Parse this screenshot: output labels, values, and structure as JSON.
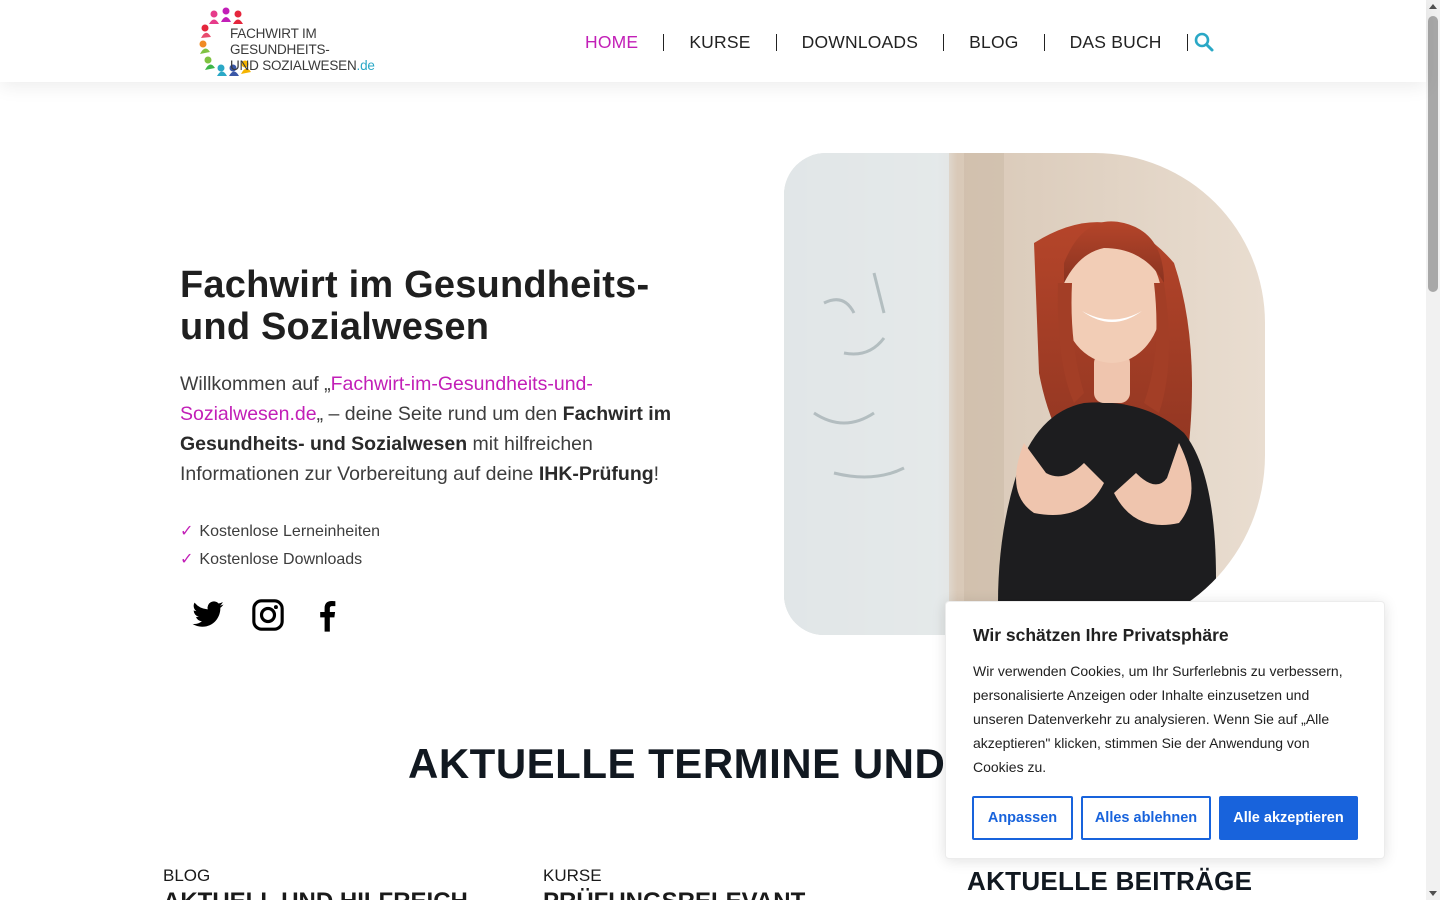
{
  "header": {
    "logo_line1": "FACHWIRT IM GESUNDHEITS-",
    "logo_line2": "UND SOZIALWESEN",
    "logo_tld": ".de",
    "nav": [
      {
        "label": "HOME",
        "active": true
      },
      {
        "label": "KURSE"
      },
      {
        "label": "DOWNLOADS"
      },
      {
        "label": "BLOG"
      },
      {
        "label": "DAS BUCH"
      }
    ],
    "search_icon": "search-icon"
  },
  "hero": {
    "title": "Fachwirt im Gesundheits- und Sozialwesen",
    "intro_prefix": "Willkommen auf „",
    "intro_link": "Fachwirt-im-Gesundheits-und-Sozialwesen.de",
    "intro_mid1": "„ – deine Seite rund um den ",
    "intro_bold1": "Fachwirt im Gesundheits- und Sozialwesen",
    "intro_mid2": " mit hilfreichen Informationen zur Vorbereitung auf deine ",
    "intro_bold2": "IHK-Prüfung",
    "intro_suffix": "!",
    "checkmark": "✓",
    "checklist": [
      "Kostenlose Lerneinheiten",
      "Kostenlose Downloads"
    ],
    "social_icons": [
      "twitter-icon",
      "instagram-icon",
      "facebook-icon"
    ]
  },
  "section": {
    "title": "AKTUELLE TERMINE UND NEWS",
    "columns": [
      {
        "label": "BLOG",
        "heading": "AKTUELL UND HILFREICH"
      },
      {
        "label": "KURSE",
        "heading": "PRÜFUNGSRELEVANT"
      }
    ],
    "sidebar_title": "AKTUELLE BEITRÄGE"
  },
  "cookie": {
    "title": "Wir schätzen Ihre Privatsphäre",
    "text": "Wir verwenden Cookies, um Ihr Surferlebnis zu verbessern, personalisierte Anzeigen oder Inhalte einzusetzen und unseren Datenverkehr zu analysieren. Wenn Sie auf „Alle akzeptieren\" klicken, stimmen Sie der Anwendung von Cookies zu.",
    "customize": "Anpassen",
    "reject": "Alles ablehnen",
    "accept": "Alle akzeptieren"
  },
  "colors": {
    "accent": "#c21fb7",
    "link_blue": "#2aa8c6",
    "cookie_blue": "#1863dc",
    "text_dark": "#1f1f1f"
  }
}
